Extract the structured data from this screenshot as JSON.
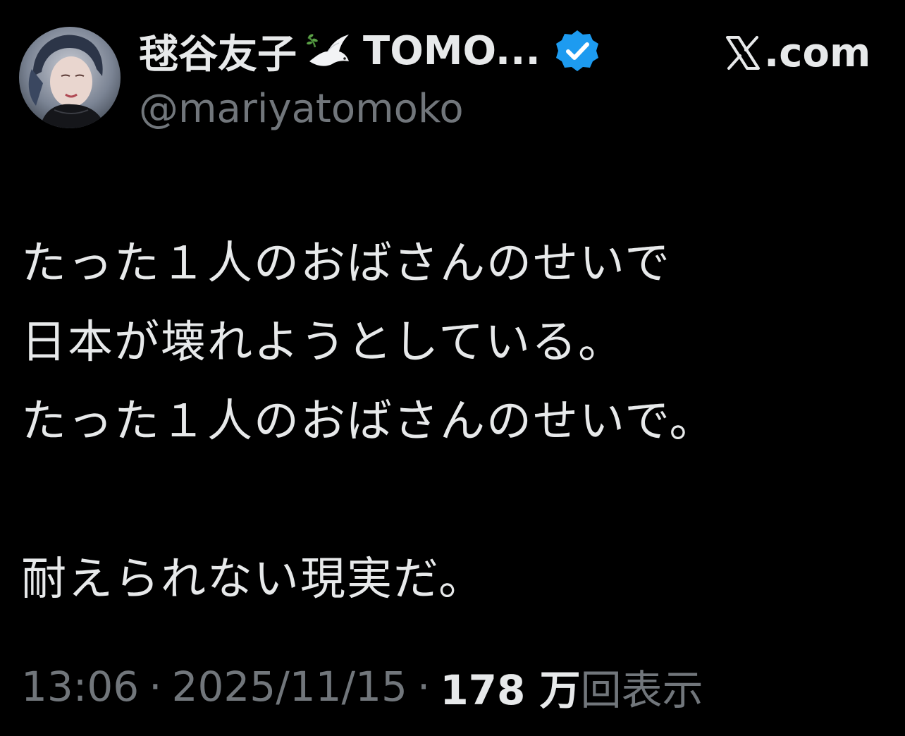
{
  "author": {
    "display_name": "毬谷友子",
    "display_name_rest": "TOMO...",
    "handle": "@mariyatomoko"
  },
  "brand": {
    "text": ".com"
  },
  "tweet": {
    "lines": [
      "たった１人のおばさんのせいで",
      "日本が壊れようとしている。",
      "たった１人のおばさんのせいで。",
      "",
      "耐えられない現実だ。"
    ]
  },
  "meta": {
    "time": "13:06",
    "separator": "·",
    "date": "2025/11/15",
    "views_count": "178 万",
    "views_label": "回表示"
  },
  "colors": {
    "background": "#000000",
    "text_primary": "#e7e9ea",
    "text_secondary": "#71767b",
    "verified_blue": "#1d9bf0"
  },
  "icons": {
    "dove": "dove-icon",
    "verified": "verified-badge-icon",
    "x_logo": "x-logo-icon"
  }
}
